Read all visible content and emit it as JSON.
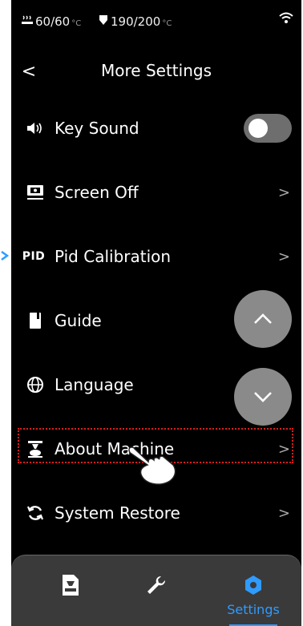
{
  "status": {
    "bed_temp": "60/60",
    "bed_unit": "°C",
    "nozzle_temp": "190/200",
    "nozzle_unit": "°C"
  },
  "header": {
    "back_symbol": "<",
    "title": "More Settings"
  },
  "menu": [
    {
      "label": "Key Sound",
      "icon": "speaker-icon",
      "control": "toggle",
      "toggle_on": false
    },
    {
      "label": "Screen Off",
      "icon": "monitor-icon",
      "control": "chevron"
    },
    {
      "label": "Pid Calibration",
      "icon": "pid-icon",
      "icon_text": "PID",
      "control": "chevron"
    },
    {
      "label": "Guide",
      "icon": "book-icon",
      "control": "none"
    },
    {
      "label": "Language",
      "icon": "globe-icon",
      "control": "none"
    },
    {
      "label": "About Machine",
      "icon": "printer-icon",
      "control": "chevron"
    },
    {
      "label": "System Restore",
      "icon": "refresh-icon",
      "control": "chevron"
    }
  ],
  "chevron_symbol": ">",
  "tabs": [
    {
      "name": "print",
      "label": ""
    },
    {
      "name": "tools",
      "label": ""
    },
    {
      "name": "settings",
      "label": "Settings",
      "active": true
    }
  ],
  "colors": {
    "accent": "#2f9bff",
    "highlight": "#e01c1c"
  }
}
